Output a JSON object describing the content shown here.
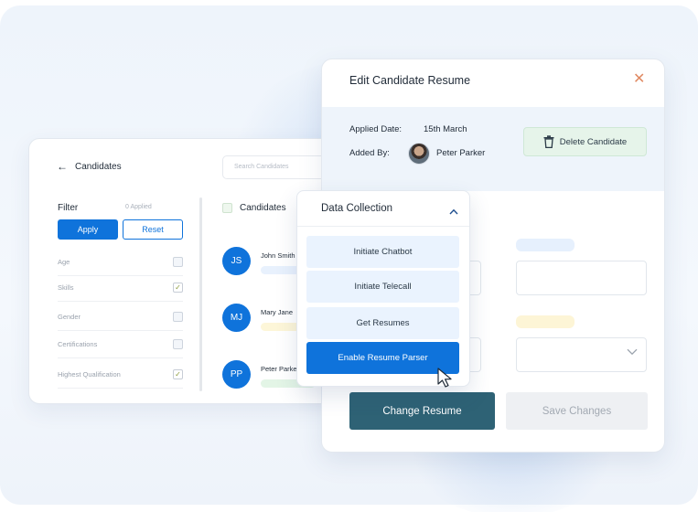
{
  "candidates_panel": {
    "title": "Candidates",
    "search_placeholder": "Search Candidates",
    "filter": {
      "title": "Filter",
      "applied": "0 Applied",
      "apply_label": "Apply",
      "reset_label": "Reset",
      "items": [
        {
          "label": "Age",
          "checked": false
        },
        {
          "label": "Skills",
          "checked": true
        },
        {
          "label": "Gender",
          "checked": false
        },
        {
          "label": "Certifications",
          "checked": false
        },
        {
          "label": "Highest Qualification",
          "checked": true
        }
      ]
    },
    "list_header": "Candidates",
    "candidates": [
      {
        "initials": "JS",
        "name": "John Smith",
        "tag_color": "#e8f1fd"
      },
      {
        "initials": "MJ",
        "name": "Mary Jane",
        "tag_color": "#fdf6d8"
      },
      {
        "initials": "PP",
        "name": "Peter Parker",
        "tag_color": "#e3f5e6"
      }
    ]
  },
  "edit_panel": {
    "title": "Edit Candidate Resume",
    "applied_date_label": "Applied Date:",
    "applied_date_value": "15th March",
    "added_by_label": "Added By:",
    "added_by_value": "Peter Parker",
    "delete_label": "Delete Candidate",
    "change_label": "Change Resume",
    "save_label": "Save Changes"
  },
  "data_collection": {
    "title": "Data Collection",
    "items": [
      {
        "label": "Initiate Chatbot",
        "active": false
      },
      {
        "label": "Initiate Telecall",
        "active": false
      },
      {
        "label": "Get Resumes",
        "active": false
      },
      {
        "label": "Enable Resume Parser",
        "active": true
      }
    ]
  },
  "colors": {
    "primary": "#0f73db",
    "change_button": "#2e6275",
    "delete_bg": "#e6f4ea",
    "info_band": "#eef4fb"
  }
}
